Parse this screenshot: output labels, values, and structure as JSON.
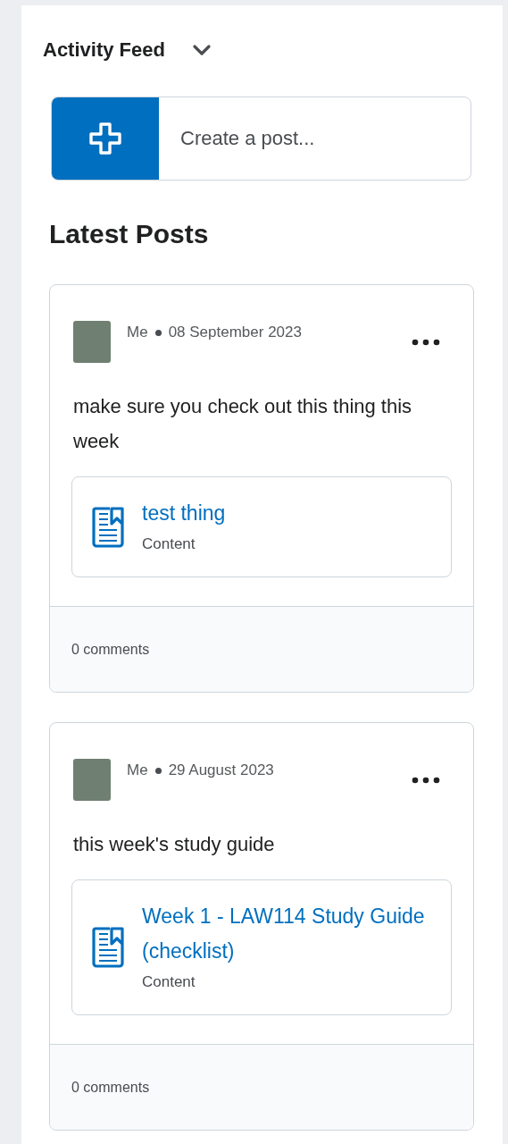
{
  "header": {
    "title": "Activity Feed"
  },
  "create_post": {
    "label": "Create a post..."
  },
  "section_title": "Latest Posts",
  "posts": [
    {
      "author": "Me",
      "date": "08 September 2023",
      "body": "make sure you check out this thing this week",
      "attachment": {
        "title": "test thing",
        "type": "Content"
      },
      "comments": "0 comments"
    },
    {
      "author": "Me",
      "date": "29 August 2023",
      "body": "this week's study guide",
      "attachment": {
        "title": "Week 1 - LAW114 Study Guide (checklist)",
        "type": "Content"
      },
      "comments": "0 comments"
    }
  ]
}
